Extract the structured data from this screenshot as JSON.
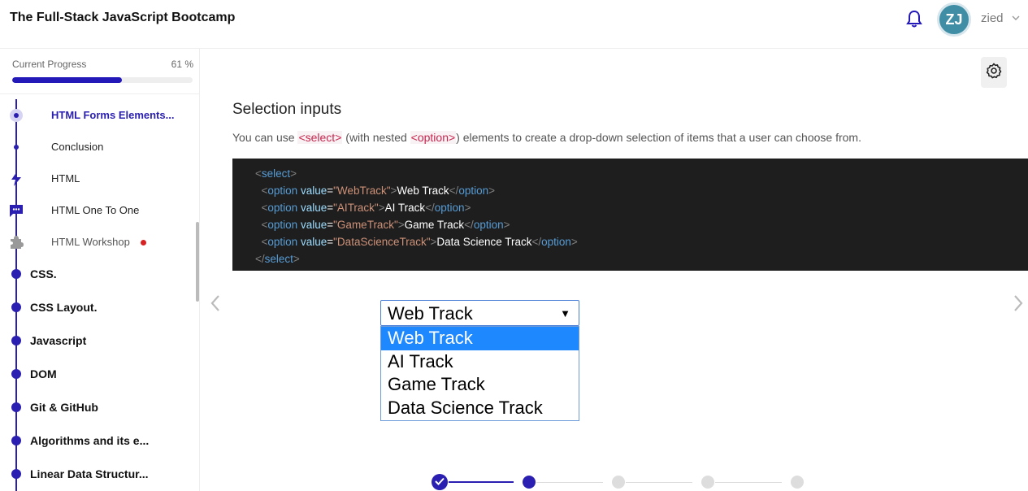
{
  "app": {
    "title": "The Full-Stack JavaScript Bootcamp"
  },
  "user": {
    "initials": "ZJ",
    "name": "zied"
  },
  "progress": {
    "label": "Current Progress",
    "value_text": "61 %",
    "fraction": 0.61
  },
  "sidebar": {
    "items": [
      {
        "label": "HTML Forms Elements...",
        "kind": "sub-active"
      },
      {
        "label": "Conclusion",
        "kind": "sub"
      },
      {
        "label": "HTML",
        "kind": "lightning-icon"
      },
      {
        "label": "HTML One To One",
        "kind": "chat-icon"
      },
      {
        "label": "HTML Workshop",
        "kind": "puzzle-icon"
      },
      {
        "label": "CSS.",
        "kind": "section"
      },
      {
        "label": "CSS Layout.",
        "kind": "section"
      },
      {
        "label": "Javascript",
        "kind": "section"
      },
      {
        "label": "DOM",
        "kind": "section"
      },
      {
        "label": "Git & GitHub",
        "kind": "section"
      },
      {
        "label": "Algorithms and its e...",
        "kind": "section"
      },
      {
        "label": "Linear Data Structur...",
        "kind": "section"
      }
    ]
  },
  "content": {
    "title": "Selection inputs",
    "desc_before": "You can use ",
    "desc_code1": "<select>",
    "desc_middle": " (with nested ",
    "desc_code2": "<option>",
    "desc_after": ") elements to create a drop-down selection of items that a user can choose from.",
    "code": {
      "select_open": "select",
      "select_close": "select",
      "option_tag": "option",
      "value_attr": "value",
      "options": [
        {
          "value": "\"WebTrack\"",
          "text": "Web Track"
        },
        {
          "value": "\"AITrack\"",
          "text": "AI Track"
        },
        {
          "value": "\"GameTrack\"",
          "text": "Game Track"
        },
        {
          "value": "\"DataScienceTrack\"",
          "text": "Data Science Track"
        }
      ]
    },
    "demo_select": {
      "selected": "Web Track",
      "options": [
        "Web Track",
        "AI Track",
        "Game Track",
        "Data Science Track"
      ]
    }
  },
  "colors": {
    "accent": "#2a1fb0",
    "code_bg": "#1e1e1e",
    "highlight": "#1e88ff"
  },
  "icons": [
    "bell-icon",
    "chevron-down-icon",
    "gear-icon",
    "lightning-icon",
    "chat-icon",
    "puzzle-icon",
    "chevron-left-icon",
    "chevron-right-icon",
    "check-icon"
  ]
}
